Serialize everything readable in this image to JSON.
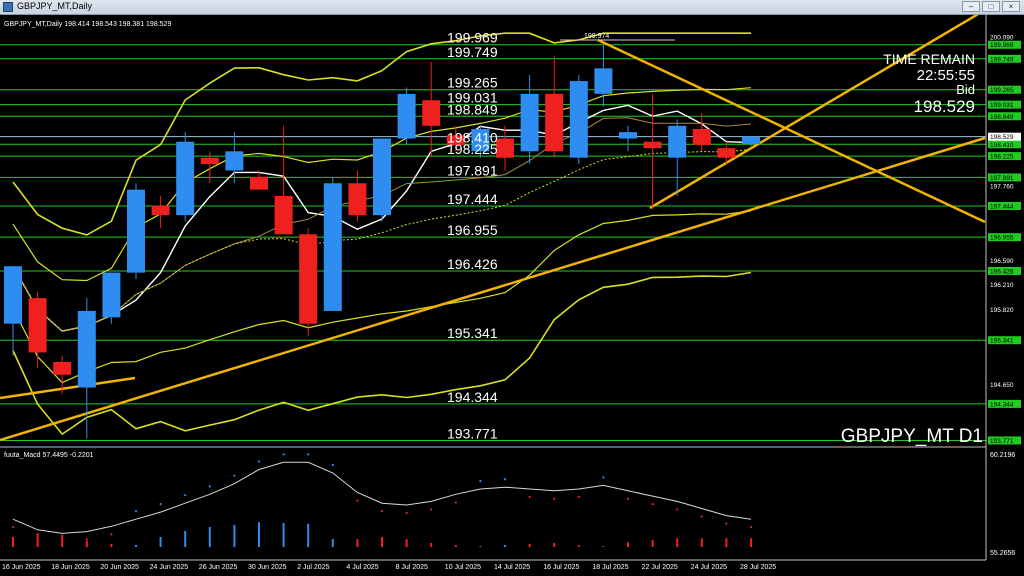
{
  "window": {
    "title": "GBPJPY_MT,Daily"
  },
  "header": {
    "symbol_info": "GBPJPY_MT,Daily  198.414 198.543 198.381 198.529",
    "corner_watermark": "GBPJPY_MT D1"
  },
  "info_panel": {
    "time_remain_label": "TIME REMAIN",
    "time_remain_value": "22:55:55",
    "bid_label": "Bid",
    "bid_value": "198.529"
  },
  "macd": {
    "label": "fuuta_Macd 57.4495  -0.2201",
    "scale_top": "60.2196",
    "scale_bottom": "55.2656"
  },
  "colors": {
    "bull": "#2f8cf0",
    "bear": "#ee2020",
    "levels": "#1fcc1f",
    "trend": "#f0b400",
    "bands": "#d8e020",
    "ma_fast": "#ffffff",
    "ma_slow": "#a98a4a",
    "current_price": "#9ec4d8"
  },
  "chart_data": {
    "type": "candlestick",
    "symbol": "GBPJPY_MT",
    "timeframe": "Daily",
    "ylim": [
      193.7,
      200.2
    ],
    "price_axis_ticks": [
      "200.090",
      "199.710",
      "199.330",
      "198.530",
      "198.150",
      "197.760",
      "197.370",
      "196.590",
      "196.210",
      "195.820",
      "195.430",
      "194.650",
      "194.270",
      "193.880"
    ],
    "levels": [
      199.969,
      199.749,
      199.265,
      199.031,
      198.849,
      198.41,
      198.225,
      197.891,
      197.444,
      196.955,
      196.426,
      195.341,
      194.344,
      193.771
    ],
    "level_labels": [
      "199.969",
      "199.749",
      "199.265",
      "199.031",
      "198.849",
      "198.410",
      "198.225",
      "197.891",
      "197.444",
      "196.955",
      "196.426",
      "195.341",
      "194.344",
      "193.771"
    ],
    "high_marker": "199.974",
    "current_price": "198.529",
    "date_labels": [
      "16 Jun 2025",
      "18 Jun 2025",
      "20 Jun 2025",
      "24 Jun 2025",
      "26 Jun 2025",
      "30 Jun 2025",
      "2 Jul 2025",
      "4 Jul 2025",
      "8 Jul 2025",
      "10 Jul 2025",
      "14 Jul 2025",
      "16 Jul 2025",
      "18 Jul 2025",
      "22 Jul 2025",
      "24 Jul 2025",
      "28 Jul 2025"
    ],
    "candles": [
      {
        "o": 195.6,
        "h": 196.5,
        "l": 195.1,
        "c": 196.5
      },
      {
        "o": 196.0,
        "h": 196.1,
        "l": 194.9,
        "c": 195.15
      },
      {
        "o": 195.0,
        "h": 195.1,
        "l": 194.5,
        "c": 194.8
      },
      {
        "o": 194.6,
        "h": 196.0,
        "l": 193.8,
        "c": 195.8
      },
      {
        "o": 195.7,
        "h": 196.4,
        "l": 195.6,
        "c": 196.4
      },
      {
        "o": 196.4,
        "h": 197.8,
        "l": 196.3,
        "c": 197.7
      },
      {
        "o": 197.45,
        "h": 197.6,
        "l": 197.1,
        "c": 197.3
      },
      {
        "o": 197.3,
        "h": 198.6,
        "l": 197.2,
        "c": 198.45
      },
      {
        "o": 198.2,
        "h": 198.3,
        "l": 197.8,
        "c": 198.1
      },
      {
        "o": 198.0,
        "h": 198.6,
        "l": 197.8,
        "c": 198.3
      },
      {
        "o": 197.9,
        "h": 198.0,
        "l": 197.7,
        "c": 197.7
      },
      {
        "o": 197.6,
        "h": 198.7,
        "l": 197.0,
        "c": 197.0
      },
      {
        "o": 197.0,
        "h": 197.1,
        "l": 195.4,
        "c": 195.6
      },
      {
        "o": 195.8,
        "h": 197.9,
        "l": 195.8,
        "c": 197.8
      },
      {
        "o": 197.8,
        "h": 198.0,
        "l": 197.2,
        "c": 197.3
      },
      {
        "o": 197.3,
        "h": 198.5,
        "l": 197.2,
        "c": 198.5
      },
      {
        "o": 198.5,
        "h": 199.3,
        "l": 198.4,
        "c": 199.2
      },
      {
        "o": 199.1,
        "h": 199.7,
        "l": 198.2,
        "c": 198.7
      },
      {
        "o": 198.55,
        "h": 198.7,
        "l": 198.3,
        "c": 198.4
      },
      {
        "o": 198.3,
        "h": 198.7,
        "l": 198.2,
        "c": 198.65
      },
      {
        "o": 198.5,
        "h": 198.7,
        "l": 198.0,
        "c": 198.2
      },
      {
        "o": 198.3,
        "h": 199.5,
        "l": 198.1,
        "c": 199.2
      },
      {
        "o": 199.2,
        "h": 199.8,
        "l": 198.2,
        "c": 198.3
      },
      {
        "o": 198.2,
        "h": 199.5,
        "l": 198.1,
        "c": 199.4
      },
      {
        "o": 199.2,
        "h": 199.974,
        "l": 199.0,
        "c": 199.6
      },
      {
        "o": 198.5,
        "h": 198.7,
        "l": 198.3,
        "c": 198.6
      },
      {
        "o": 198.45,
        "h": 199.2,
        "l": 197.4,
        "c": 198.35
      },
      {
        "o": 198.2,
        "h": 198.8,
        "l": 197.6,
        "c": 198.7
      },
      {
        "o": 198.65,
        "h": 198.9,
        "l": 198.3,
        "c": 198.4
      },
      {
        "o": 198.35,
        "h": 198.45,
        "l": 198.1,
        "c": 198.2
      },
      {
        "o": 198.414,
        "h": 198.543,
        "l": 198.381,
        "c": 198.529
      }
    ],
    "macd_series": {
      "line": [
        57.0,
        56.4,
        56.2,
        56.3,
        56.6,
        57.0,
        57.4,
        57.9,
        58.4,
        59.0,
        59.8,
        60.2,
        60.2,
        59.6,
        58.5,
        57.9,
        57.8,
        58.0,
        58.4,
        58.7,
        58.8,
        58.7,
        58.6,
        58.7,
        58.9,
        58.6,
        58.3,
        58.0,
        57.6,
        57.2,
        57.0
      ],
      "histogram": [
        -0.25,
        -0.35,
        -0.3,
        -0.15,
        -0.08,
        0.05,
        0.25,
        0.4,
        0.5,
        0.55,
        0.62,
        0.6,
        0.58,
        0.2,
        -0.2,
        -0.25,
        -0.2,
        -0.1,
        -0.05,
        0.02,
        0.05,
        -0.08,
        -0.1,
        -0.05,
        0.02,
        -0.12,
        -0.18,
        -0.22,
        -0.22,
        -0.22,
        -0.22
      ]
    }
  }
}
